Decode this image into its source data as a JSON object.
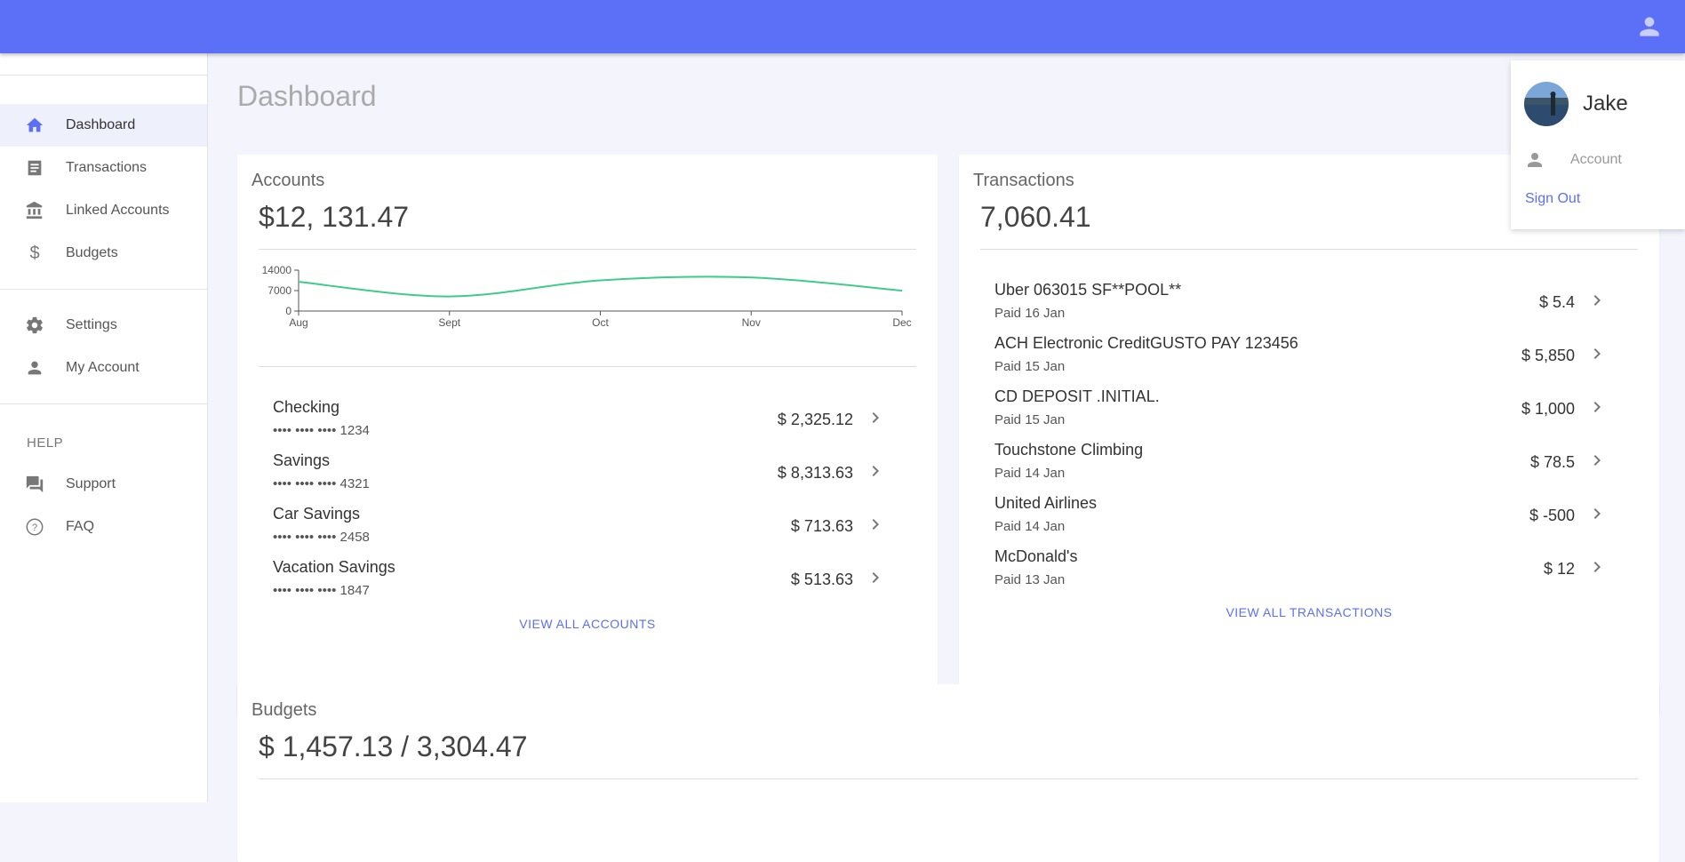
{
  "sidebar": {
    "items": [
      {
        "label": "Dashboard"
      },
      {
        "label": "Transactions"
      },
      {
        "label": "Linked Accounts"
      },
      {
        "label": "Budgets"
      },
      {
        "label": "Settings"
      },
      {
        "label": "My Account"
      },
      {
        "label": "Support"
      },
      {
        "label": "FAQ"
      }
    ],
    "help_heading": "HELP"
  },
  "page": {
    "title": "Dashboard"
  },
  "accounts": {
    "title": "Accounts",
    "total": "$12, 131.47",
    "list": [
      {
        "name": "Checking",
        "number": "•••• •••• •••• 1234",
        "amount": "$ 2,325.12"
      },
      {
        "name": "Savings",
        "number": "•••• •••• •••• 4321",
        "amount": "$ 8,313.63"
      },
      {
        "name": "Car Savings",
        "number": "•••• •••• •••• 2458",
        "amount": "$ 713.63"
      },
      {
        "name": "Vacation Savings",
        "number": "•••• •••• •••• 1847",
        "amount": "$ 513.63"
      }
    ],
    "view_all": "VIEW ALL ACCOUNTS"
  },
  "transactions": {
    "title": "Transactions",
    "total": "7,060.41",
    "list": [
      {
        "name": "Uber 063015 SF**POOL**",
        "date": "Paid 16 Jan",
        "amount": "$ 5.4"
      },
      {
        "name": "ACH Electronic CreditGUSTO PAY 123456",
        "date": "Paid 15 Jan",
        "amount": "$ 5,850"
      },
      {
        "name": "CD DEPOSIT .INITIAL.",
        "date": "Paid 15 Jan",
        "amount": "$ 1,000"
      },
      {
        "name": "Touchstone Climbing",
        "date": "Paid 14 Jan",
        "amount": "$ 78.5"
      },
      {
        "name": "United Airlines",
        "date": "Paid 14 Jan",
        "amount": "$ -500"
      },
      {
        "name": "McDonald's",
        "date": "Paid 13 Jan",
        "amount": "$ 12"
      }
    ],
    "view_all": "VIEW ALL TRANSACTIONS"
  },
  "budgets": {
    "title": "Budgets",
    "total": "$ 1,457.13 / 3,304.47"
  },
  "user_menu": {
    "name": "Jake",
    "account_label": "Account",
    "sign_out": "Sign Out"
  },
  "colors": {
    "accent": "#5b6ff7",
    "chart_line": "#3ecb8c"
  },
  "chart_data": {
    "type": "line",
    "x": [
      "Aug",
      "Sept",
      "Oct",
      "Nov",
      "Dec"
    ],
    "series": [
      {
        "values": [
          10000,
          5000,
          10500,
          11500,
          7000
        ]
      }
    ],
    "y_ticks": [
      "0",
      "7000",
      "14000"
    ],
    "ylim": [
      0,
      14000
    ],
    "grid": false
  }
}
